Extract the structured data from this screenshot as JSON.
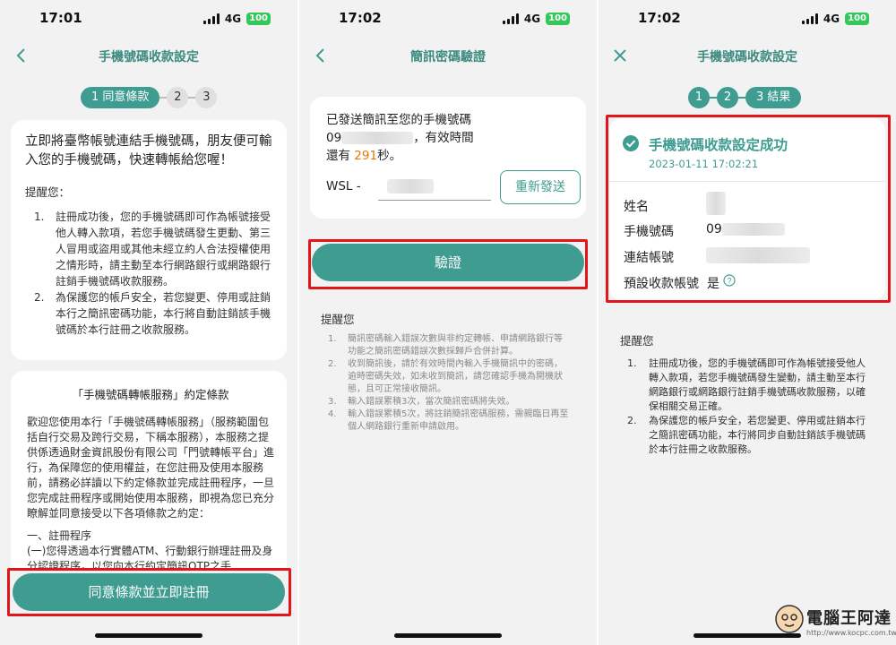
{
  "screen1": {
    "time": "17:01",
    "network": "4G",
    "battery": "100",
    "title": "手機號碼收款設定",
    "steps": {
      "step1": "1 同意條款",
      "step2": "2",
      "step3": "3"
    },
    "intro": "立即將臺幣帳號連結手機號碼，朋友便可輸入您的手機號碼，快速轉帳給您喔！",
    "remind_title": "提醒您：",
    "terms": [
      {
        "num": "1.",
        "text": "註冊成功後，您的手機號碼即可作為帳號接受他人轉入款項，若您手機號碼發生更動、第三人冒用或盜用或其他未經立約人合法授權使用之情形時，請主動至本行網路銀行或網路銀行註銷手機號碼收款服務。"
      },
      {
        "num": "2.",
        "text": "為保護您的帳戶安全，若您變更、停用或註銷本行之簡訊密碼功能，本行將自動註銷該手機號碼於本行註冊之收款服務。"
      }
    ],
    "agreement_title": "「手機號碼轉帳服務」約定條款",
    "agreement_body": "歡迎您使用本行「手機號碼轉帳服務」（服務範圍包括自行交易及跨行交易，下稱本服務），本服務之提供係透過財金資訊股份有限公司「門號轉帳平台」進行，為保障您的使用權益，在您註冊及使用本服務前，請務必詳讀以下約定條款並完成註冊程序，一旦您完成註冊程序或開始使用本服務，即視為您已充分瞭解並同意接受以下各項條款之約定：",
    "section1": "一、註冊程序",
    "section1_body": "(一)您得透過本行實體ATM、行動銀行辦理註冊及身分認證程序，以您向本行約定簡訊OTP之手",
    "agree_button": "同意條款並立即註冊"
  },
  "screen2": {
    "time": "17:02",
    "network": "4G",
    "battery": "100",
    "title": "簡訊密碼驗證",
    "sent_line1": "已發送簡訊至您的手機號碼",
    "phone_prefix": "09",
    "sent_line2_suffix": "，有效時間",
    "remaining_prefix": "還有",
    "remaining_seconds": "291",
    "remaining_suffix": "秒。",
    "code_prefix": "WSL -",
    "resend_button": "重新發送",
    "verify_button": "驗證",
    "remind_title": "提醒您",
    "notes": [
      {
        "num": "1.",
        "text": "簡訊密碼輸入錯誤次數與非約定轉帳、申請網路銀行等功能之簡訊密碼錯誤次數採歸戶合併計算。"
      },
      {
        "num": "2.",
        "text": "收到簡訊後，請於有效時間內輸入手機簡訊中的密碼，逾時密碼失效，如未收到簡訊，請您確認手機為開機狀態，且可正常接收簡訊。"
      },
      {
        "num": "3.",
        "text": "輸入錯誤累積3次，當次簡訊密碼將失效。"
      },
      {
        "num": "4.",
        "text": "輸入錯誤累積5次，將註銷簡訊密碼服務，需親臨日再至個人網路銀行重新申請啟用。"
      }
    ]
  },
  "screen3": {
    "time": "17:02",
    "network": "4G",
    "battery": "100",
    "title": "手機號碼收款設定",
    "steps": {
      "step1": "1",
      "step2": "2",
      "step3": "3 結果"
    },
    "success_title": "手機號碼收款設定成功",
    "timestamp": "2023-01-11 17:02:21",
    "fields": {
      "name_label": "姓名",
      "phone_label": "手機號碼",
      "phone_prefix": "09",
      "account_label": "連結帳號",
      "default_label": "預設收款帳號",
      "default_value": "是"
    },
    "remind_title": "提醒您",
    "notes": [
      {
        "num": "1.",
        "text": "註冊成功後，您的手機號碼即可作為帳號接受他人轉入款項，若您手機號碼發生變動，請主動至本行網路銀行或網路銀行註銷手機號碼收款服務，以確保相關交易正確。"
      },
      {
        "num": "2.",
        "text": "為保護您的帳戶安全，若您變更、停用或註銷本行之簡訊密碼功能，本行將同步自動註銷該手機號碼於本行註冊之收款服務。"
      }
    ]
  },
  "watermark": {
    "brand": "電腦王阿達",
    "url": "http://www.kocpc.com.tw"
  },
  "colors": {
    "accent": "#3f9c91",
    "highlight_box": "#e0161b",
    "countdown": "#e07b00",
    "success": "#3f9c91"
  }
}
